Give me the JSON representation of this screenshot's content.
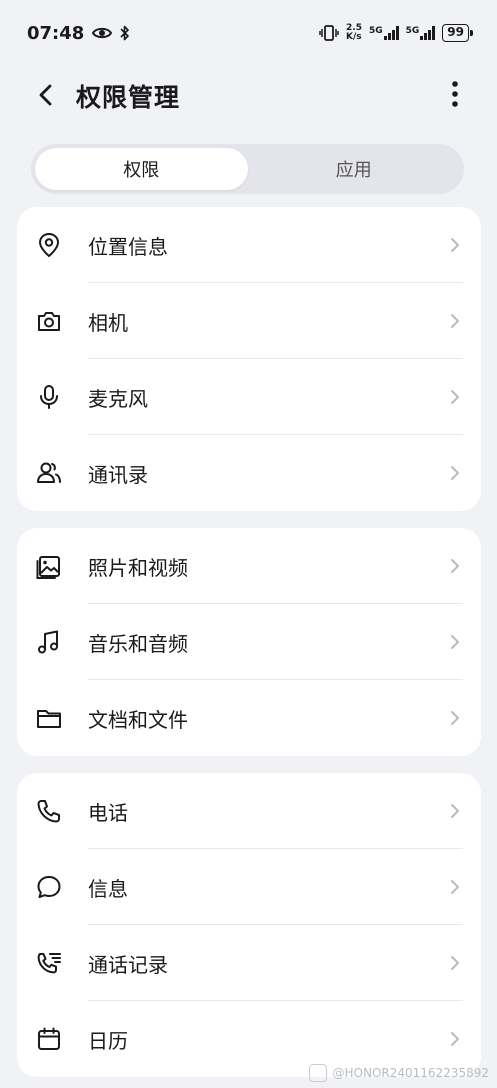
{
  "status_bar": {
    "time": "07:48",
    "net_speed_value": "2.5",
    "net_speed_unit": "K/s",
    "sim1_label": "5G",
    "sim2_label": "5G",
    "battery": "99",
    "icons": [
      "eye-icon",
      "bluetooth-icon",
      "vibrate-icon",
      "signal-icon",
      "battery-icon"
    ]
  },
  "header": {
    "title": "权限管理",
    "back_icon": "chevron-left-icon",
    "more_icon": "more-vertical-icon"
  },
  "tabs": [
    {
      "label": "权限",
      "active": true
    },
    {
      "label": "应用",
      "active": false
    }
  ],
  "groups": [
    {
      "items": [
        {
          "label": "位置信息",
          "icon": "location-pin-icon"
        },
        {
          "label": "相机",
          "icon": "camera-icon"
        },
        {
          "label": "麦克风",
          "icon": "microphone-icon"
        },
        {
          "label": "通讯录",
          "icon": "contacts-icon"
        }
      ]
    },
    {
      "items": [
        {
          "label": "照片和视频",
          "icon": "photo-icon"
        },
        {
          "label": "音乐和音频",
          "icon": "music-note-icon"
        },
        {
          "label": "文档和文件",
          "icon": "folder-icon"
        }
      ]
    },
    {
      "items": [
        {
          "label": "电话",
          "icon": "phone-icon"
        },
        {
          "label": "信息",
          "icon": "message-icon"
        },
        {
          "label": "通话记录",
          "icon": "call-log-icon"
        },
        {
          "label": "日历",
          "icon": "calendar-icon"
        }
      ]
    }
  ],
  "watermark": "@HONOR2401162235892",
  "colors": {
    "background": "#f1f2f6",
    "card": "#ffffff",
    "text": "#1a1a1a",
    "chevron": "#b8bbc2"
  }
}
